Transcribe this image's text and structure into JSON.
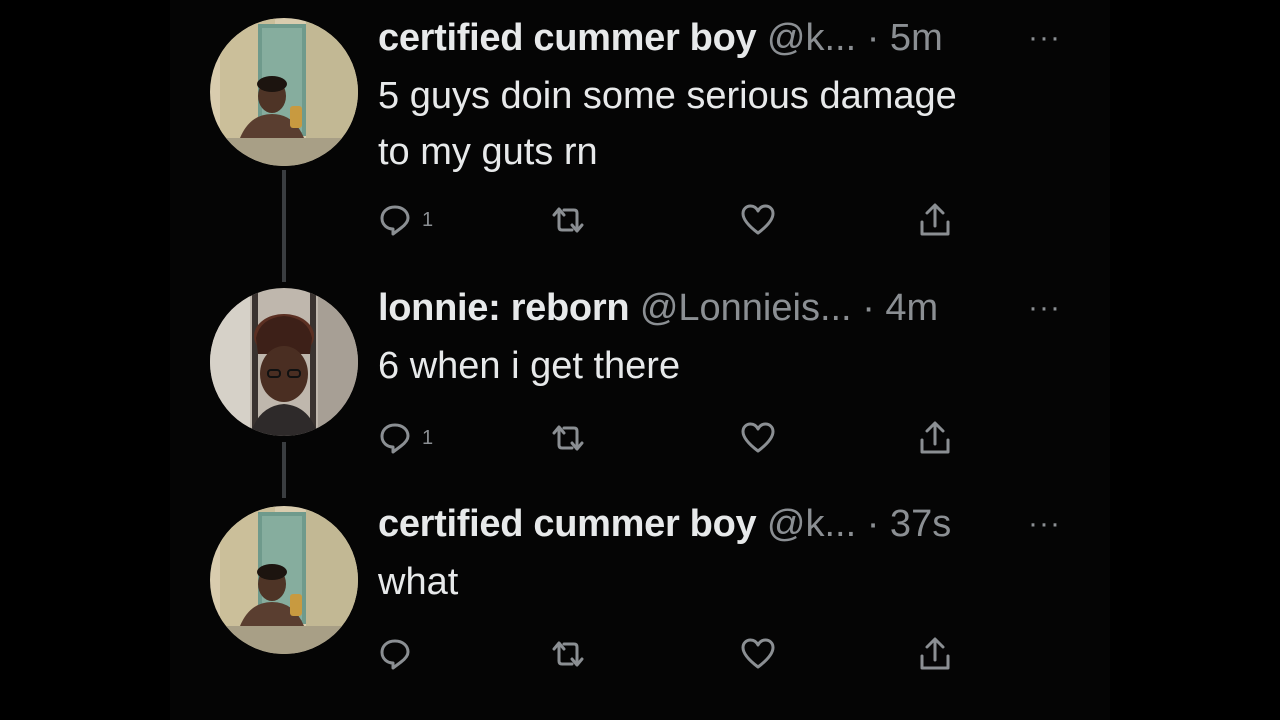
{
  "tweets": [
    {
      "name": "certified cummer boy",
      "handle": "@k...",
      "time": "· 5m",
      "more": "···",
      "text": "5 guys doin some serious damage\nto my guts rn",
      "reply_count": "1",
      "avatar": "person-selfie-avatar"
    },
    {
      "name": "lonnie: reborn",
      "handle": "@Lonnieis...",
      "time": "· 4m",
      "more": "···",
      "text": "6 when i get there",
      "reply_count": "1",
      "avatar": "person-dreadlocks-avatar"
    },
    {
      "name": "certified cummer boy",
      "handle": "@k...",
      "time": "· 37s",
      "more": "···",
      "text": "what",
      "reply_count": "",
      "avatar": "person-selfie-avatar"
    }
  ],
  "icons": {
    "reply": "reply-icon",
    "retweet": "retweet-icon",
    "like": "like-icon",
    "share": "share-icon"
  },
  "colors": {
    "background": "#000000",
    "primary_text": "#e7e9ea",
    "secondary_text": "#8b8f93",
    "thread_line": "#3a3d40"
  }
}
